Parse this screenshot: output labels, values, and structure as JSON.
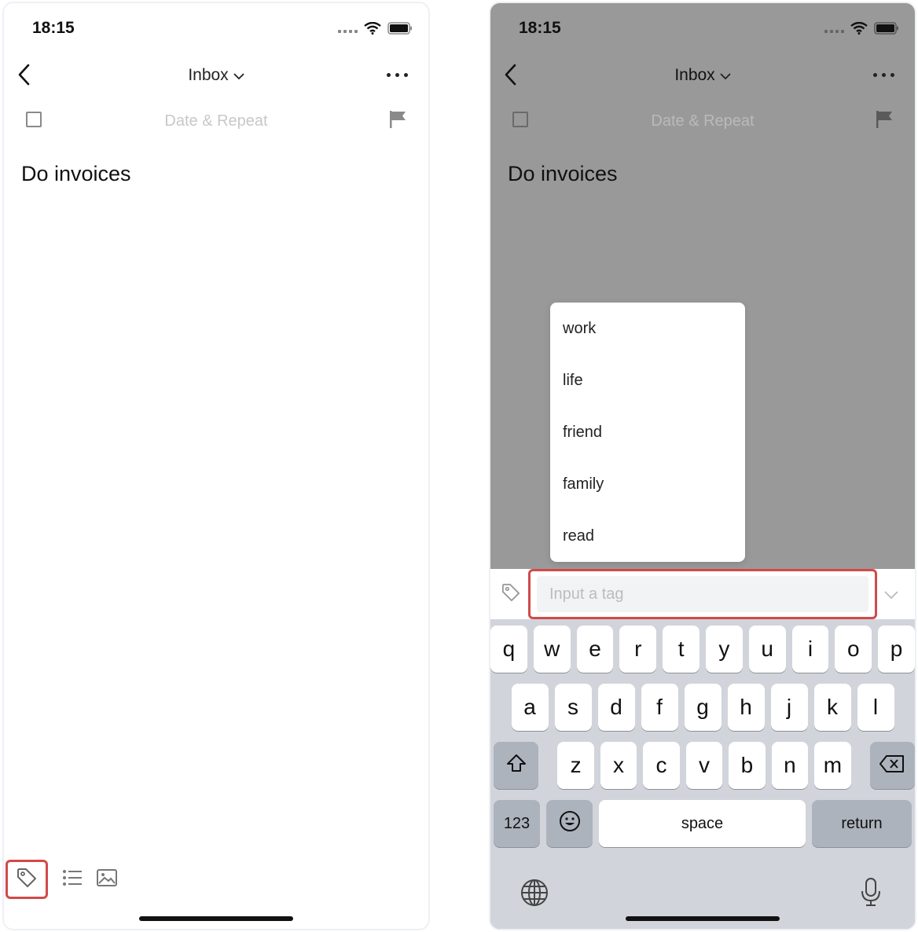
{
  "left_screen": {
    "status_time": "18:15",
    "nav_title": "Inbox",
    "date_repeat_label": "Date & Repeat",
    "task_title": "Do invoices",
    "toolbar_icons": [
      "tag-icon",
      "checklist-icon",
      "image-icon"
    ]
  },
  "right_screen": {
    "status_time": "18:15",
    "nav_title": "Inbox",
    "date_repeat_label": "Date & Repeat",
    "task_title": "Do invoices",
    "tag_suggestions": [
      "work",
      "life",
      "friend",
      "family",
      "read"
    ],
    "tag_input": {
      "placeholder": "Input a tag",
      "value": ""
    },
    "keyboard": {
      "row1": [
        "q",
        "w",
        "e",
        "r",
        "t",
        "y",
        "u",
        "i",
        "o",
        "p"
      ],
      "row2": [
        "a",
        "s",
        "d",
        "f",
        "g",
        "h",
        "j",
        "k",
        "l"
      ],
      "row3": [
        "z",
        "x",
        "c",
        "v",
        "b",
        "n",
        "m"
      ],
      "numbers_key": "123",
      "space_key": "space",
      "return_key": "return"
    }
  },
  "colors": {
    "highlight": "#d14a4a",
    "overlay": "#999999",
    "keyboard_bg": "#d1d4da"
  }
}
